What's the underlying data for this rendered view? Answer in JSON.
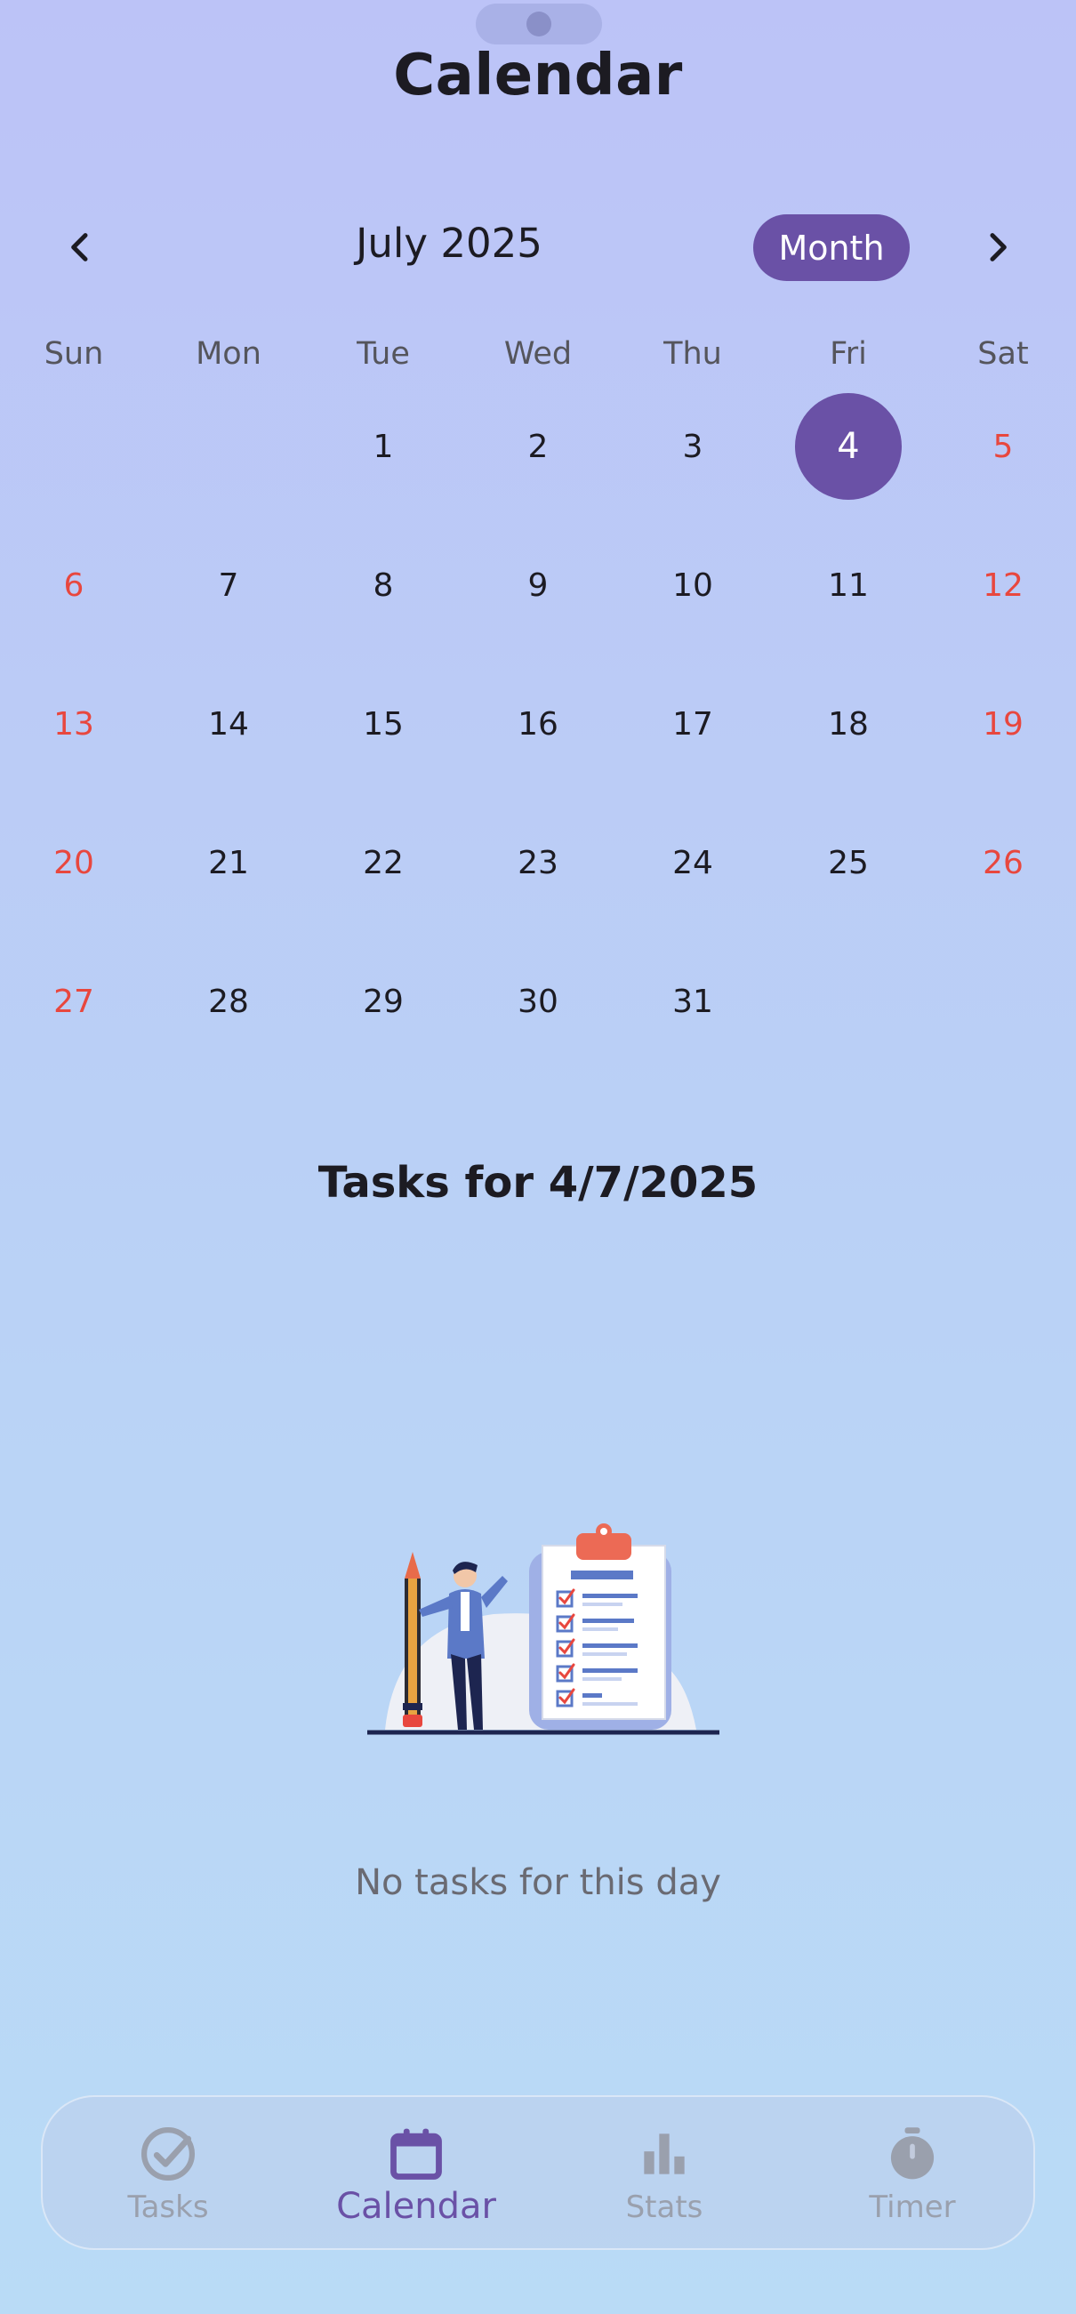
{
  "header": {
    "title": "Calendar"
  },
  "calendar": {
    "month_label": "July 2025",
    "view_mode": "Month",
    "weekdays": [
      "Sun",
      "Mon",
      "Tue",
      "Wed",
      "Thu",
      "Fri",
      "Sat"
    ],
    "weeks": [
      [
        "",
        "",
        "1",
        "2",
        "3",
        "4",
        "5"
      ],
      [
        "6",
        "7",
        "8",
        "9",
        "10",
        "11",
        "12"
      ],
      [
        "13",
        "14",
        "15",
        "16",
        "17",
        "18",
        "19"
      ],
      [
        "20",
        "21",
        "22",
        "23",
        "24",
        "25",
        "26"
      ],
      [
        "27",
        "28",
        "29",
        "30",
        "31",
        "",
        ""
      ]
    ],
    "selected_day": "4"
  },
  "tasks": {
    "title": "Tasks for 4/7/2025",
    "empty_message": "No tasks for this day"
  },
  "bottom_nav": {
    "items": [
      {
        "label": "Tasks",
        "icon": "check-circle-icon"
      },
      {
        "label": "Calendar",
        "icon": "calendar-icon"
      },
      {
        "label": "Stats",
        "icon": "bar-chart-icon"
      },
      {
        "label": "Timer",
        "icon": "stopwatch-icon"
      }
    ],
    "active": "Calendar"
  },
  "colors": {
    "accent": "#6a51a6",
    "weekend": "#e8473e",
    "inactive": "#9aa0ad"
  }
}
